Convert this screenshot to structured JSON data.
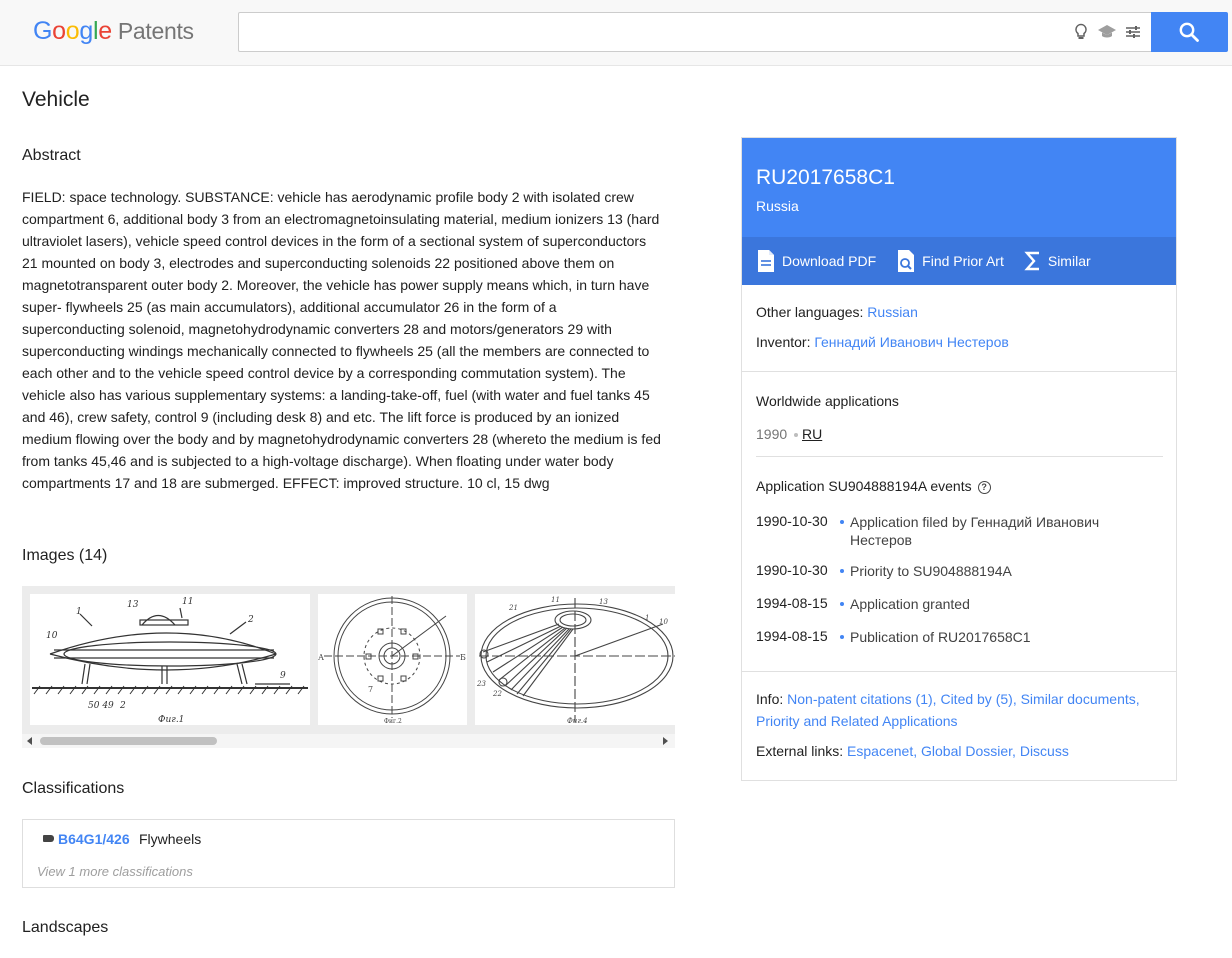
{
  "header": {
    "logo_letters": [
      "G",
      "o",
      "o",
      "g",
      "l",
      "e"
    ],
    "logo_suffix": "Patents",
    "search": {
      "value": "",
      "placeholder": ""
    },
    "icons": [
      "lightbulb-icon",
      "scholar-icon",
      "tune-icon",
      "search-icon"
    ]
  },
  "main": {
    "title": "Vehicle",
    "abstract_heading": "Abstract",
    "abstract_text": "FIELD: space technology. SUBSTANCE: vehicle has aerodynamic profile body 2 with isolated crew compartment 6, additional body 3 from an electromagnetoinsulating material, medium ionizers 13 (hard ultraviolet lasers), vehicle speed control devices in the form of a sectional system of superconductors 21 mounted on body 3, electrodes and superconducting solenoids 22 positioned above them on magnetotransparent outer body 2. Moreover, the vehicle has power supply means which, in turn have super- flywheels 25 (as main accumulators), additional accumulator 26 in the form of a superconducting solenoid, magnetohydrodynamic converters 28 and motors/generators 29 with superconducting windings mechanically connected to flywheels 25 (all the members are connected to each other and to the vehicle speed control device by a corresponding commutation system). The vehicle also has various supplementary systems: a landing-take-off, fuel (with water and fuel tanks 45 and 46), crew safety, control 9 (including desk 8) and etc. The lift force is produced by an ionized medium flowing over the body and by magnetohydrodynamic converters 28 (whereto the medium is fed from tanks 45,46 and is subjected to a high-voltage discharge). When floating under water body compartments 17 and 18 are submerged. EFFECT: improved structure. 10 cl, 15 dwg",
    "images_heading": "Images (14)",
    "images": [
      {
        "caption": "Фиг.1",
        "labels": [
          "1",
          "13",
          "11",
          "2",
          "10",
          "9",
          "50 49",
          "2"
        ]
      },
      {
        "caption": "Фиг.2",
        "labels": [
          "А",
          "Б",
          "7"
        ]
      },
      {
        "caption": "Фиг.4",
        "labels": [
          "11",
          "13",
          "21",
          "1",
          "10",
          "23",
          "22"
        ]
      }
    ],
    "classifications_heading": "Classifications",
    "classification": {
      "code": "B64G1/426",
      "description": "Flywheels"
    },
    "classification_more": "View 1 more classifications",
    "landscapes_heading": "Landscapes"
  },
  "card": {
    "pub_number": "RU2017658C1",
    "country": "Russia",
    "actions": [
      {
        "label": "Download PDF",
        "icon": "pdf-icon"
      },
      {
        "label": "Find Prior Art",
        "icon": "prior-art-icon"
      },
      {
        "label": "Similar",
        "icon": "sigma-icon"
      }
    ],
    "other_languages_label": "Other languages:",
    "other_languages_value": "Russian",
    "inventor_label": "Inventor:",
    "inventor_value": "Геннадий Иванович Нестеров",
    "worldwide_heading": "Worldwide applications",
    "worldwide_year": "1990",
    "worldwide_country": "RU",
    "events_heading": "Application SU904888194A events",
    "events": [
      {
        "date": "1990-10-30",
        "desc": "Application filed by Геннадий Иванович Нестеров"
      },
      {
        "date": "1990-10-30",
        "desc": "Priority to SU904888194A"
      },
      {
        "date": "1994-08-15",
        "desc": "Application granted"
      },
      {
        "date": "1994-08-15",
        "desc": "Publication of RU2017658C1"
      }
    ],
    "info_label": "Info:",
    "info_links": [
      "Non-patent citations (1)",
      "Cited by (5)",
      "Similar documents",
      "Priority and Related Applications"
    ],
    "external_label": "External links:",
    "external_links": [
      "Espacenet",
      "Global Dossier",
      "Discuss"
    ]
  }
}
